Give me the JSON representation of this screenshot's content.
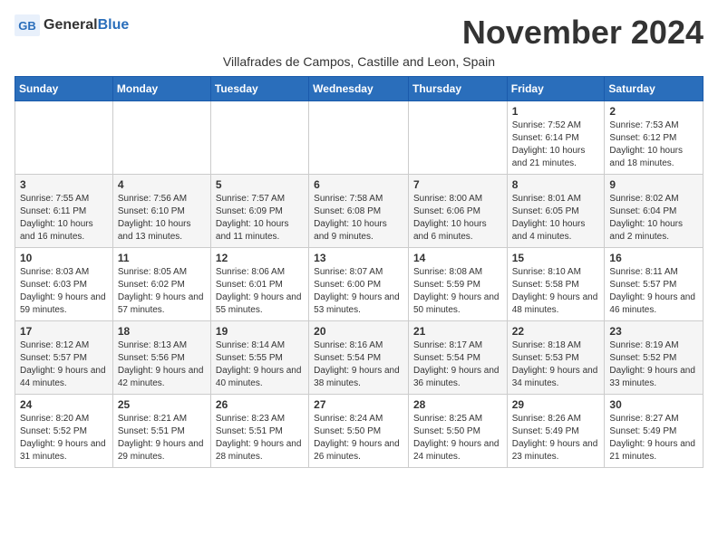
{
  "header": {
    "logo_general": "General",
    "logo_blue": "Blue",
    "title": "November 2024",
    "subtitle": "Villafrades de Campos, Castille and Leon, Spain"
  },
  "weekdays": [
    "Sunday",
    "Monday",
    "Tuesday",
    "Wednesday",
    "Thursday",
    "Friday",
    "Saturday"
  ],
  "weeks": [
    [
      {
        "day": "",
        "info": ""
      },
      {
        "day": "",
        "info": ""
      },
      {
        "day": "",
        "info": ""
      },
      {
        "day": "",
        "info": ""
      },
      {
        "day": "",
        "info": ""
      },
      {
        "day": "1",
        "info": "Sunrise: 7:52 AM\nSunset: 6:14 PM\nDaylight: 10 hours and 21 minutes."
      },
      {
        "day": "2",
        "info": "Sunrise: 7:53 AM\nSunset: 6:12 PM\nDaylight: 10 hours and 18 minutes."
      }
    ],
    [
      {
        "day": "3",
        "info": "Sunrise: 7:55 AM\nSunset: 6:11 PM\nDaylight: 10 hours and 16 minutes."
      },
      {
        "day": "4",
        "info": "Sunrise: 7:56 AM\nSunset: 6:10 PM\nDaylight: 10 hours and 13 minutes."
      },
      {
        "day": "5",
        "info": "Sunrise: 7:57 AM\nSunset: 6:09 PM\nDaylight: 10 hours and 11 minutes."
      },
      {
        "day": "6",
        "info": "Sunrise: 7:58 AM\nSunset: 6:08 PM\nDaylight: 10 hours and 9 minutes."
      },
      {
        "day": "7",
        "info": "Sunrise: 8:00 AM\nSunset: 6:06 PM\nDaylight: 10 hours and 6 minutes."
      },
      {
        "day": "8",
        "info": "Sunrise: 8:01 AM\nSunset: 6:05 PM\nDaylight: 10 hours and 4 minutes."
      },
      {
        "day": "9",
        "info": "Sunrise: 8:02 AM\nSunset: 6:04 PM\nDaylight: 10 hours and 2 minutes."
      }
    ],
    [
      {
        "day": "10",
        "info": "Sunrise: 8:03 AM\nSunset: 6:03 PM\nDaylight: 9 hours and 59 minutes."
      },
      {
        "day": "11",
        "info": "Sunrise: 8:05 AM\nSunset: 6:02 PM\nDaylight: 9 hours and 57 minutes."
      },
      {
        "day": "12",
        "info": "Sunrise: 8:06 AM\nSunset: 6:01 PM\nDaylight: 9 hours and 55 minutes."
      },
      {
        "day": "13",
        "info": "Sunrise: 8:07 AM\nSunset: 6:00 PM\nDaylight: 9 hours and 53 minutes."
      },
      {
        "day": "14",
        "info": "Sunrise: 8:08 AM\nSunset: 5:59 PM\nDaylight: 9 hours and 50 minutes."
      },
      {
        "day": "15",
        "info": "Sunrise: 8:10 AM\nSunset: 5:58 PM\nDaylight: 9 hours and 48 minutes."
      },
      {
        "day": "16",
        "info": "Sunrise: 8:11 AM\nSunset: 5:57 PM\nDaylight: 9 hours and 46 minutes."
      }
    ],
    [
      {
        "day": "17",
        "info": "Sunrise: 8:12 AM\nSunset: 5:57 PM\nDaylight: 9 hours and 44 minutes."
      },
      {
        "day": "18",
        "info": "Sunrise: 8:13 AM\nSunset: 5:56 PM\nDaylight: 9 hours and 42 minutes."
      },
      {
        "day": "19",
        "info": "Sunrise: 8:14 AM\nSunset: 5:55 PM\nDaylight: 9 hours and 40 minutes."
      },
      {
        "day": "20",
        "info": "Sunrise: 8:16 AM\nSunset: 5:54 PM\nDaylight: 9 hours and 38 minutes."
      },
      {
        "day": "21",
        "info": "Sunrise: 8:17 AM\nSunset: 5:54 PM\nDaylight: 9 hours and 36 minutes."
      },
      {
        "day": "22",
        "info": "Sunrise: 8:18 AM\nSunset: 5:53 PM\nDaylight: 9 hours and 34 minutes."
      },
      {
        "day": "23",
        "info": "Sunrise: 8:19 AM\nSunset: 5:52 PM\nDaylight: 9 hours and 33 minutes."
      }
    ],
    [
      {
        "day": "24",
        "info": "Sunrise: 8:20 AM\nSunset: 5:52 PM\nDaylight: 9 hours and 31 minutes."
      },
      {
        "day": "25",
        "info": "Sunrise: 8:21 AM\nSunset: 5:51 PM\nDaylight: 9 hours and 29 minutes."
      },
      {
        "day": "26",
        "info": "Sunrise: 8:23 AM\nSunset: 5:51 PM\nDaylight: 9 hours and 28 minutes."
      },
      {
        "day": "27",
        "info": "Sunrise: 8:24 AM\nSunset: 5:50 PM\nDaylight: 9 hours and 26 minutes."
      },
      {
        "day": "28",
        "info": "Sunrise: 8:25 AM\nSunset: 5:50 PM\nDaylight: 9 hours and 24 minutes."
      },
      {
        "day": "29",
        "info": "Sunrise: 8:26 AM\nSunset: 5:49 PM\nDaylight: 9 hours and 23 minutes."
      },
      {
        "day": "30",
        "info": "Sunrise: 8:27 AM\nSunset: 5:49 PM\nDaylight: 9 hours and 21 minutes."
      }
    ]
  ]
}
